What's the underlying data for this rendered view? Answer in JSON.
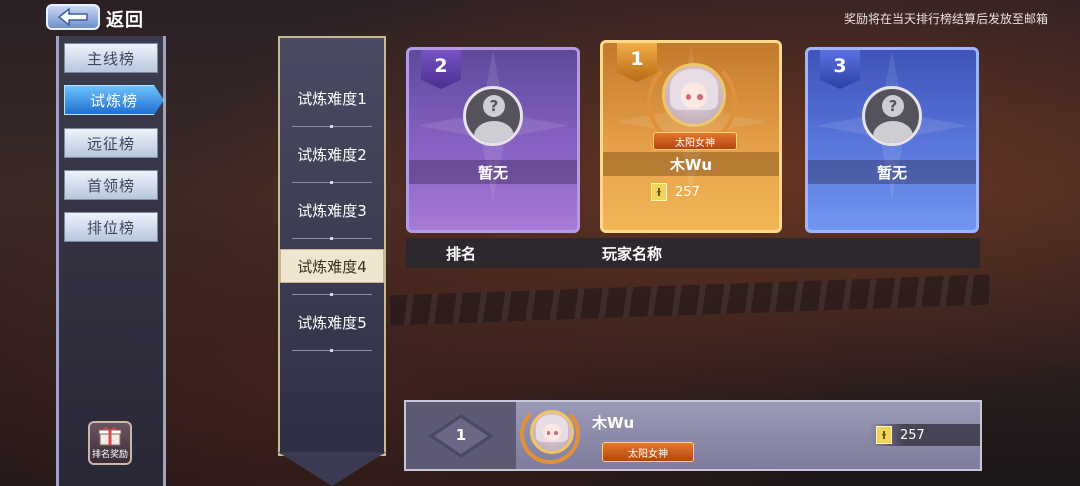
{
  "topbar": {
    "back_label": "返回",
    "notice": "奖励将在当天排行榜结算后发放至邮箱"
  },
  "tabs": [
    "主线榜",
    "试炼榜",
    "远征榜",
    "首领榜",
    "排位榜"
  ],
  "active_tab": "试炼榜",
  "reward_button": "排名奖励",
  "difficulties": [
    "试炼难度1",
    "试炼难度2",
    "试炼难度3",
    "试炼难度4",
    "试炼难度5"
  ],
  "active_difficulty": "试炼难度4",
  "podium": {
    "first": {
      "rank": "1",
      "name": "木Wu",
      "title": "太阳女神",
      "score": "257"
    },
    "second": {
      "rank": "2",
      "name": "暂无"
    },
    "third": {
      "rank": "3",
      "name": "暂无"
    }
  },
  "table_header": {
    "rank": "排名",
    "player": "玩家名称"
  },
  "my_entry": {
    "rank": "1",
    "name": "木Wu",
    "title": "太阳女神",
    "score": "257"
  },
  "colors": {
    "gold_card": "#e8a34a",
    "silver_card": "#8c64c8",
    "bronze_card": "#5b7be0",
    "active_tab": "#1f6fd1"
  }
}
